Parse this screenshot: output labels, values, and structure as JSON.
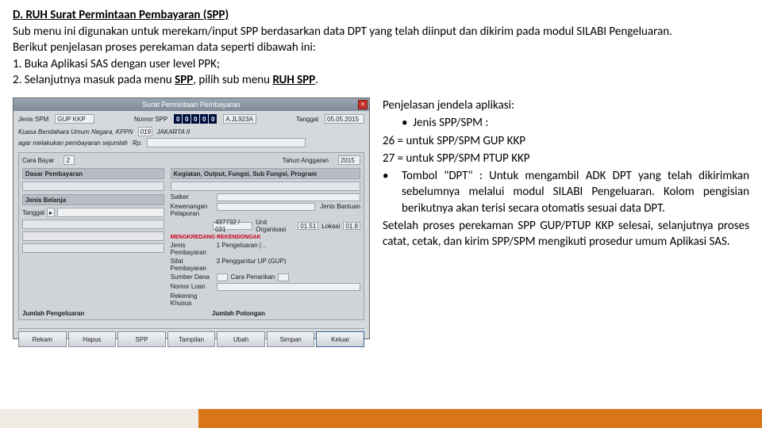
{
  "doc": {
    "heading": "D. RUH Surat Permintaan Pembayaran (SPP)",
    "p1": "Sub menu ini digunakan untuk merekam/input SPP berdasarkan data DPT yang telah diinput dan dikirim pada modul SILABI Pengeluaran.",
    "p2": "Berikut penjelasan proses perekaman data seperti dibawah ini:",
    "p3": "1. Buka Aplikasi SAS dengan user level PPK;",
    "p4a": "2. Selanjutnya masuk pada menu ",
    "p4b": "SPP",
    "p4c": ", pilih sub menu ",
    "p4d": "RUH SPP",
    "p4e": "."
  },
  "app": {
    "title": "Surat Permintaan Pembayaran",
    "jenis_spm_lbl": "Jenis SPM",
    "jenis_spm_val": "GUP KKP",
    "nomor_lbl": "Nomor SPP",
    "nomor_letter": "A.JL923A",
    "tanggal_lbl": "Tanggal",
    "tanggal_val": "05.05.2015",
    "quote1": "Kuasa Bendahara Umum Negara, KPPN",
    "quote2": "agar melakukan pembayaran sejumlah",
    "kppn": "JAKARTA II",
    "rp": "Rp.",
    "cara_lbl": "Cara Bayar",
    "cara_val": "2",
    "tahun_lbl": "Tahun Anggaran",
    "tahun_val": "2015",
    "dasar_hdr": "Dasar Pembayaran",
    "kogiatan_hdr": "Kegiatan, Output, Fungsi, Sub Fungsi, Program",
    "jenis_belanja_hdr": "Jenis Belanja",
    "satker_lbl": "Satker",
    "satker_val": "437732 / 031",
    "kew_lbl": "Kewenangan Pelaporan",
    "unit_lbl": "Unit Organisasi",
    "unit_val": "01.51",
    "lok_lbl": "Lokasi",
    "lok_val": "01.8",
    "jenis_bantuan_lbl": "Jenis Bantuan",
    "red_text": "MENGKREDANG REKENDONGAK",
    "jenis_pemb_lbl": "Jenis Pembayaran",
    "jenis_pemb_val": "1 Pengeluaran | ..",
    "sifat_lbl": "Sifat Pembayaran",
    "sifat_val": "3 Pengganitur UP (GUP)",
    "sumber_lbl": "Sumber Dana",
    "cara_pen_lbl": "Cara Penarikan",
    "nomor_loan_lbl": "Nomor Loan",
    "rek_khusus_lbl": "Rekening Khusus",
    "jml_peng_lbl": "Jumlah Pengeluaran",
    "jml_pot_lbl": "Jumlah Potongan",
    "btn_rekam": "Rekam",
    "btn_hapus": "Hapus",
    "btn_spp": "SPP",
    "btn_tampil": "Tampilan",
    "btn_ubah": "Ubah",
    "btn_simpan": "Simpan",
    "btn_keluar": "Keluar"
  },
  "rhs": {
    "l1": "Penjelasan jendela aplikasi:",
    "l2": "Jenis SPP/SPM :",
    "l3": "26 = untuk SPP/SPM GUP KKP",
    "l4": "27 = untuk SPP/SPM PTUP KKP",
    "l5": "Tombol \"DPT\" : Untuk mengambil ADK DPT yang telah dikirimkan sebelumnya melalui modul SILABI Pengeluaran. Kolom pengisian berikutnya akan terisi secara otomatis sesuai data DPT.",
    "l6": "Setelah proses perekaman SPP GUP/PTUP KKP selesai, selanjutnya proses catat, cetak, dan kirim SPP/SPM mengikuti prosedur umum Aplikasi SAS."
  }
}
